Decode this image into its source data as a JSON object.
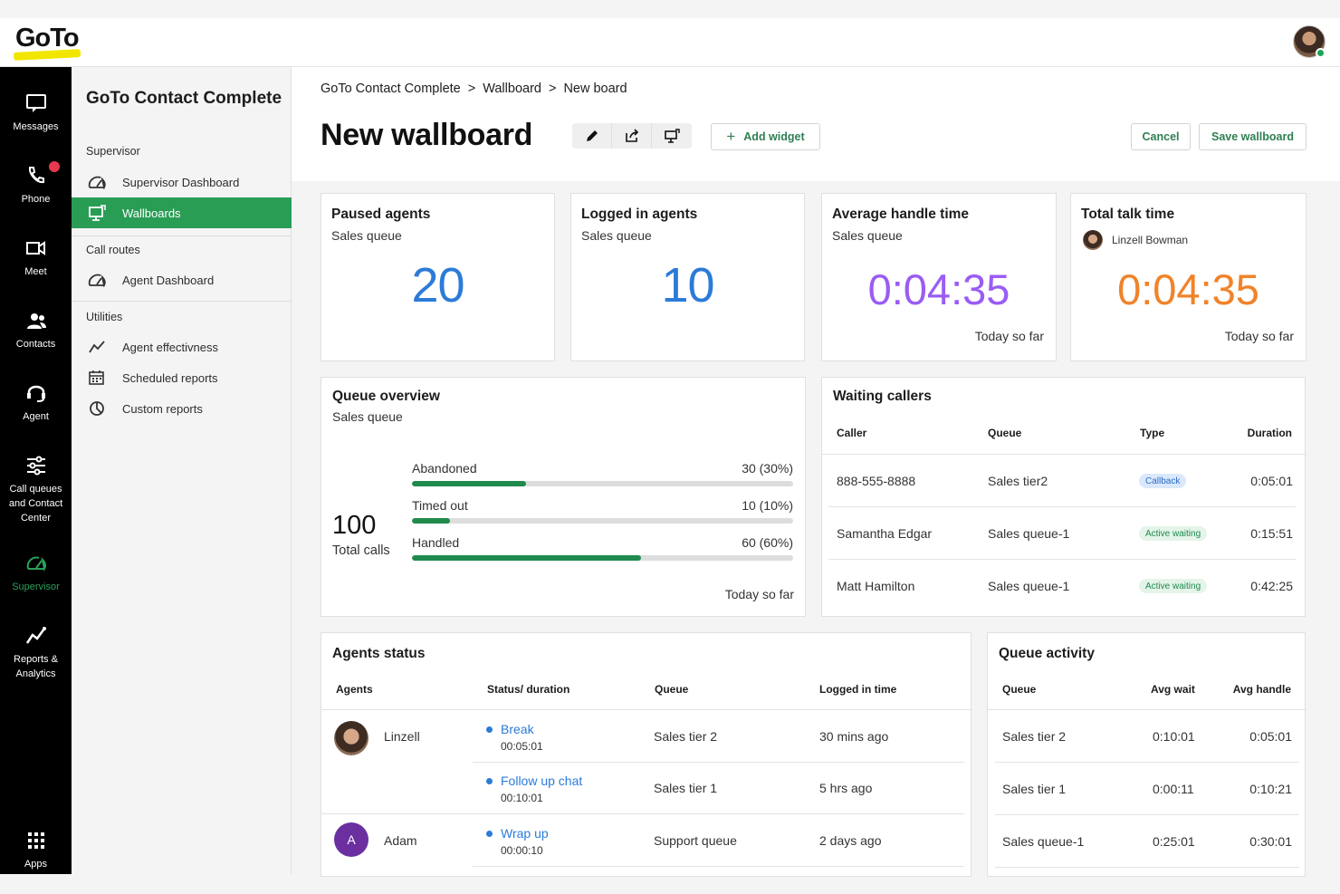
{
  "topbar": {
    "logo": "GoTo"
  },
  "rail": {
    "items": [
      {
        "label": "Messages",
        "icon": "message-icon"
      },
      {
        "label": "Phone",
        "icon": "phone-icon"
      },
      {
        "label": "Meet",
        "icon": "video-icon"
      },
      {
        "label": "Contacts",
        "icon": "contacts-icon"
      },
      {
        "label": "Agent",
        "icon": "headset-icon"
      },
      {
        "label": "Call queues and Contact Center",
        "icon": "sliders-icon"
      },
      {
        "label": "Supervisor",
        "icon": "gauge-icon"
      },
      {
        "label": "Reports & Analytics",
        "icon": "chart-icon"
      },
      {
        "label": "Apps",
        "icon": "apps-grid-icon"
      }
    ]
  },
  "subnav": {
    "title": "GoTo Contact Complete",
    "sections": [
      {
        "label": "Supervisor",
        "items": [
          "Supervisor Dashboard",
          "Wallboards"
        ]
      },
      {
        "label": "Call routes",
        "items": [
          "Agent Dashboard"
        ]
      },
      {
        "label": "Utilities",
        "items": [
          "Agent effectivness",
          "Scheduled reports",
          "Custom reports"
        ]
      }
    ]
  },
  "breadcrumb": [
    "GoTo Contact Complete",
    "Wallboard",
    "New board"
  ],
  "page_title": "New wallboard",
  "actions": {
    "add_widget": "Add widget",
    "cancel": "Cancel",
    "save": "Save wallboard"
  },
  "kpis": [
    {
      "title": "Paused agents",
      "subtitle": "Sales queue",
      "value": "20",
      "color": "#2c7bd8"
    },
    {
      "title": "Logged in agents",
      "subtitle": "Sales queue",
      "value": "10",
      "color": "#2c7bd8"
    },
    {
      "title": "Average handle time",
      "subtitle": "Sales queue",
      "value": "0:04:35",
      "footer": "Today so far",
      "color": "#9a5cf5"
    },
    {
      "title": "Total talk time",
      "person": "Linzell Bowman",
      "value": "0:04:35",
      "footer": "Today so far",
      "color": "#f0832a"
    }
  ],
  "queue_overview": {
    "title": "Queue overview",
    "subtitle": "Sales queue",
    "total": "100",
    "total_label": "Total calls",
    "footer": "Today so far",
    "rows": [
      {
        "label": "Abandoned",
        "value": "30 (30%)",
        "pct": 0.3
      },
      {
        "label": "Timed out",
        "value": "10 (10%)",
        "pct": 0.1
      },
      {
        "label": "Handled",
        "value": "60 (60%)",
        "pct": 0.6
      }
    ]
  },
  "waiting_callers": {
    "title": "Waiting callers",
    "headers": [
      "Caller",
      "Queue",
      "Type",
      "Duration"
    ],
    "rows": [
      {
        "caller": "888-555-8888",
        "queue": "Sales tier2",
        "type": "Callback",
        "duration": "0:05:01"
      },
      {
        "caller": "Samantha Edgar",
        "queue": "Sales queue-1",
        "type": "Active waiting",
        "duration": "0:15:51"
      },
      {
        "caller": "Matt Hamilton",
        "queue": "Sales queue-1",
        "type": "Active waiting",
        "duration": "0:42:25"
      }
    ]
  },
  "agents_status": {
    "title": "Agents status",
    "headers": [
      "Agents",
      "Status/ duration",
      "Queue",
      "Logged in time"
    ],
    "rows": [
      {
        "agent": "Linzell",
        "status": "Break",
        "duration": "00:05:01",
        "queue": "Sales tier 2",
        "logged": "30 mins ago"
      },
      {
        "agent": "",
        "status": "Follow up chat",
        "duration": "00:10:01",
        "queue": "Sales tier 1",
        "logged": "5 hrs ago"
      },
      {
        "agent": "Adam",
        "initial": "A",
        "status": "Wrap up",
        "duration": "00:00:10",
        "queue": "Support queue",
        "logged": "2 days ago"
      }
    ]
  },
  "queue_activity": {
    "title": "Queue activity",
    "headers": [
      "Queue",
      "Avg wait",
      "Avg handle"
    ],
    "rows": [
      {
        "queue": "Sales tier 2",
        "wait": "0:10:01",
        "handle": "0:05:01"
      },
      {
        "queue": "Sales tier 1",
        "wait": "0:00:11",
        "handle": "0:10:21"
      },
      {
        "queue": "Sales queue-1",
        "wait": "0:25:01",
        "handle": "0:30:01"
      }
    ]
  }
}
